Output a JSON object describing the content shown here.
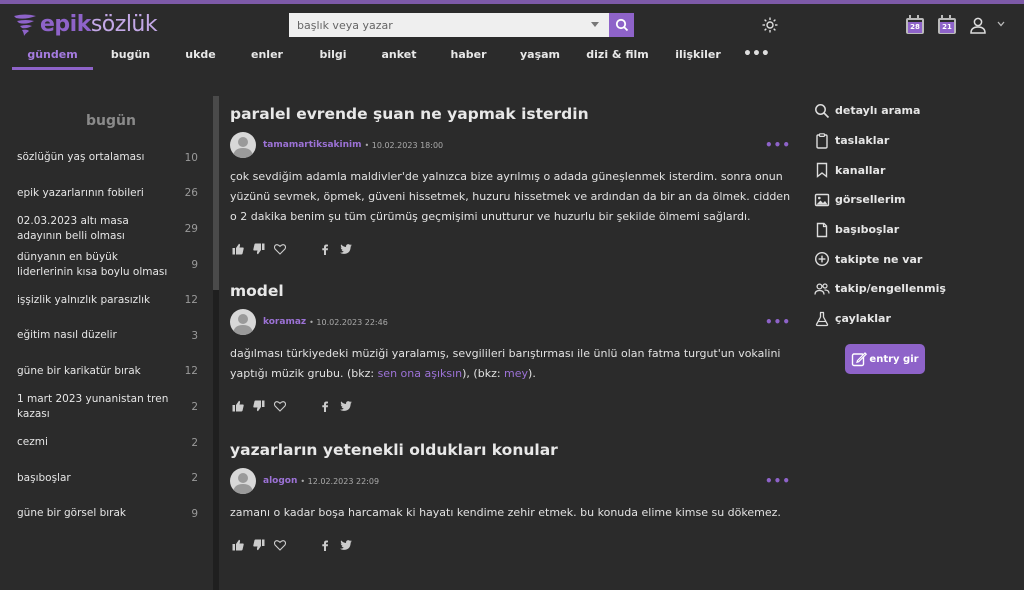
{
  "header": {
    "logo": {
      "brand": "epik",
      "suffix": "sözlük"
    },
    "search": {
      "placeholder": "başlık veya yazar"
    },
    "calendar_badges": [
      "28",
      "21"
    ]
  },
  "nav": {
    "tabs": [
      {
        "label": "gündem",
        "active": true
      },
      {
        "label": "bugün"
      },
      {
        "label": "ukde"
      },
      {
        "label": "enler"
      },
      {
        "label": "bilgi"
      },
      {
        "label": "anket"
      },
      {
        "label": "haber"
      },
      {
        "label": "yaşam"
      },
      {
        "label": "dizi & film"
      },
      {
        "label": "ilişkiler"
      }
    ],
    "more": "•••"
  },
  "sidebar": {
    "title": "bugün",
    "items": [
      {
        "label": "sözlüğün yaş ortalaması",
        "count": "10"
      },
      {
        "label": "epik yazarlarının fobileri",
        "count": "26"
      },
      {
        "label": "02.03.2023 altı masa adayının belli olması",
        "count": "29"
      },
      {
        "label": "dünyanın en büyük liderlerinin kısa boylu olması",
        "count": "9"
      },
      {
        "label": "işşizlik yalnızlık parasızlık",
        "count": "12"
      },
      {
        "label": "eğitim nasıl düzelir",
        "count": "3"
      },
      {
        "label": "güne bir karikatür bırak",
        "count": "12"
      },
      {
        "label": "1 mart 2023 yunanistan tren kazası",
        "count": "2"
      },
      {
        "label": "cezmi",
        "count": "2"
      },
      {
        "label": "başıboşlar",
        "count": "2"
      },
      {
        "label": "güne bir görsel bırak",
        "count": "9"
      }
    ]
  },
  "topics": [
    {
      "title": "paralel evrende şuan ne yapmak isterdin",
      "author": "tamamartiksakinim",
      "date": "• 10.02.2023 18:00",
      "dots": "•••",
      "body": "çok sevdiğim adamla maldivler'de yalnızca bize ayrılmış o adada güneşlenmek isterdim. sonra onun yüzünü sevmek, öpmek, güveni hissetmek, huzuru hissetmek ve ardından da bir an da ölmek. cidden o 2 dakika benim şu tüm çürümüş geçmişimi unutturur ve huzurlu bir şekilde ölmemi sağlardı."
    },
    {
      "title": "model",
      "author": "koramaz",
      "date": "• 10.02.2023 22:46",
      "dots": "•••",
      "body_pre": "dağılması türkiyedeki müziği yaralamış, sevgilileri barıştırması ile ünlü olan fatma turgut'un vokalini yaptığı müzik grubu. (bkz: ",
      "link1": "sen ona aşıksın",
      "body_mid": "), (bkz: ",
      "link2": "mey",
      "body_post": ")."
    },
    {
      "title": "yazarların yetenekli oldukları konular",
      "author": "alogon",
      "date": "• 12.02.2023 22:09",
      "dots": "•••",
      "body": "zamanı o kadar boşa harcamak ki hayatı kendime zehir etmek. bu konuda elime kimse su dökemez."
    }
  ],
  "rightbar": {
    "items": [
      {
        "label": "detaylı arama",
        "icon": "search-icon"
      },
      {
        "label": "taslaklar",
        "icon": "draft-icon"
      },
      {
        "label": "kanallar",
        "icon": "bookmark-icon"
      },
      {
        "label": "görsellerim",
        "icon": "image-icon"
      },
      {
        "label": "başıboşlar",
        "icon": "document-icon"
      },
      {
        "label": "takipte ne var",
        "icon": "plus-circle-icon"
      },
      {
        "label": "takip/engellenmiş",
        "icon": "users-icon"
      },
      {
        "label": "çaylaklar",
        "icon": "flask-icon"
      }
    ],
    "entry_button": "entry gir"
  },
  "colors": {
    "accent": "#8e63c9",
    "background": "#2b2b2b",
    "link": "#9c72d6"
  }
}
